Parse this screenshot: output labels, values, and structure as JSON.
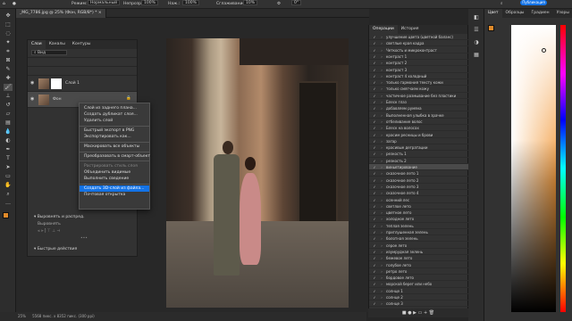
{
  "options_bar": {
    "mode_label": "Режим:",
    "mode_value": "Нормальный",
    "opacity_label": "Непрозр.:",
    "opacity_value": "100%",
    "pressure_label": "Наж.:",
    "pressure_value": "100%",
    "smoothing_label": "Сглаживание:",
    "smoothing_value": "10%",
    "angle_value": "0°",
    "publish_label": "Публикация"
  },
  "document_tab": {
    "title": "_MG_7786.jpg @ 25% (Фон, RGB/8*) *"
  },
  "layers_panel": {
    "tabs": [
      "Слои",
      "Каналы",
      "Контуры"
    ],
    "filter_label": "Вид",
    "layers": [
      {
        "name": "Слой 1"
      },
      {
        "name": "Фон"
      }
    ]
  },
  "context_menu": {
    "items": [
      {
        "label": "Слой из заднего плана...",
        "disabled": false
      },
      {
        "label": "Создать дубликат слоя...",
        "disabled": false
      },
      {
        "label": "Удалить слой",
        "disabled": false
      },
      {
        "sep": true
      },
      {
        "label": "Быстрый экспорт в PNG",
        "disabled": false
      },
      {
        "label": "Экспортировать как...",
        "disabled": false
      },
      {
        "sep": true
      },
      {
        "label": "Маскировать все объекты",
        "disabled": false
      },
      {
        "sep": true
      },
      {
        "label": "Преобразовать в смарт-объект",
        "disabled": false
      },
      {
        "sep": true
      },
      {
        "label": "Растрировать стиль слоя",
        "disabled": true
      },
      {
        "label": "Объединить видимые",
        "disabled": false
      },
      {
        "label": "Выполнить сведение",
        "disabled": false
      },
      {
        "sep": true
      },
      {
        "label": "Создать 3D-слой из файла...",
        "disabled": false
      },
      {
        "label": "Почтовая открытка",
        "disabled": false
      }
    ]
  },
  "properties": {
    "align_label": "Выровнять и распред.",
    "align_sub": "Выровнять",
    "quick_actions_label": "Быстрые действия"
  },
  "actions_panel": {
    "tabs": [
      "Операции",
      "История"
    ],
    "items": [
      "улучшение цвета (цветной баланс)",
      "светлые края кадра",
      "Четкость и микроконтраст",
      "контраст 1",
      "контраст 2",
      "контраст 3",
      "контраст 4 холодный",
      "только гармония тексту кожи",
      "только смягчаем кожу",
      "частичное размывание без пластики",
      "Блеск глаз",
      "добавляем румяна",
      "Выполненная улыбка в зрачке",
      "отбеливание волос",
      "Блеск на волосах",
      "красим ресницы и брови",
      "загар",
      "красивые дегратации",
      "резкость 1",
      "резкость 2",
      "виньетирование",
      "сказочное лето 1",
      "сказочное лето 2",
      "сказочное лето 3",
      "сказочное лето 4",
      "осенний лес",
      "светлое лето",
      "цветное лето",
      "холодное лето",
      "теплая зелень",
      "приглушенная зелень",
      "болотная зелень",
      "серое лето",
      "изумрудная зелень",
      "бежевое лето",
      "голубое лето",
      "ретро лето",
      "бордовое лето",
      "морской берег или небо",
      "солнце 1",
      "солнце 2",
      "солнце 3",
      "сохранение в JPG"
    ],
    "selected_index": 20
  },
  "color_panel": {
    "tabs": [
      "Цвет",
      "Образцы",
      "Градиен",
      "Узоры"
    ]
  },
  "status_bar": {
    "zoom": "25%",
    "info": "5568 пикс. x 8352 пикс. (300 ppi)"
  },
  "icons": {
    "tools": [
      "move-icon",
      "marquee-icon",
      "lasso-icon",
      "wand-icon",
      "crop-icon",
      "frame-icon",
      "eyedropper-icon",
      "heal-icon",
      "brush-icon",
      "stamp-icon",
      "history-brush-icon",
      "eraser-icon",
      "gradient-icon",
      "blur-icon",
      "dodge-icon",
      "pen-icon",
      "type-icon",
      "path-select-icon",
      "shape-icon",
      "hand-icon",
      "zoom-icon",
      "more-icon"
    ]
  }
}
